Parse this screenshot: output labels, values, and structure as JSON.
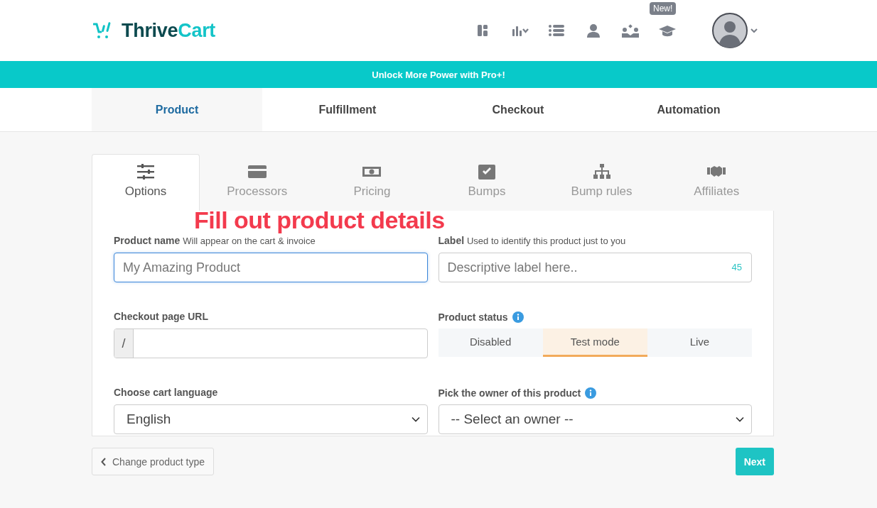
{
  "brand": {
    "name_dark": "Thrive",
    "name_light": "Cart"
  },
  "nav_icons": [
    {
      "kind": "dashboard"
    },
    {
      "kind": "chart"
    },
    {
      "kind": "list"
    },
    {
      "kind": "user"
    },
    {
      "kind": "team"
    },
    {
      "kind": "academy",
      "badge": "New!"
    }
  ],
  "banner": {
    "text": "Unlock More Power with Pro+!"
  },
  "main_tabs": [
    {
      "label": "Product",
      "selected": true
    },
    {
      "label": "Fulfillment",
      "selected": false
    },
    {
      "label": "Checkout",
      "selected": false
    },
    {
      "label": "Automation",
      "selected": false
    }
  ],
  "sub_tabs": [
    {
      "label": "Options",
      "kind": "sliders",
      "selected": true
    },
    {
      "label": "Processors",
      "kind": "card",
      "selected": false
    },
    {
      "label": "Pricing",
      "kind": "money",
      "selected": false
    },
    {
      "label": "Bumps",
      "kind": "check",
      "selected": false
    },
    {
      "label": "Bump rules",
      "kind": "tree",
      "selected": false
    },
    {
      "label": "Affiliates",
      "kind": "handshake",
      "selected": false
    }
  ],
  "annotation": "Fill out product details",
  "form": {
    "product_name": {
      "label": "Product name",
      "hint": "Will appear on the cart & invoice",
      "placeholder": "My Amazing Product",
      "focused": true
    },
    "label": {
      "label": "Label",
      "hint": "Used to identify this product just to you",
      "placeholder": "Descriptive label here..",
      "counter": "45",
      "focused": false
    },
    "checkout_url": {
      "label": "Checkout page URL",
      "prefix": "/"
    },
    "product_status": {
      "label": "Product status",
      "options": [
        {
          "label": "Disabled",
          "selected": false
        },
        {
          "label": "Test mode",
          "selected": true
        },
        {
          "label": "Live",
          "selected": false
        }
      ]
    },
    "cart_language": {
      "label": "Choose cart language",
      "value": "English"
    },
    "owner": {
      "label": "Pick the owner of this product",
      "value": "-- Select an owner --"
    }
  },
  "footer": {
    "back": "Change product type",
    "next": "Next"
  }
}
